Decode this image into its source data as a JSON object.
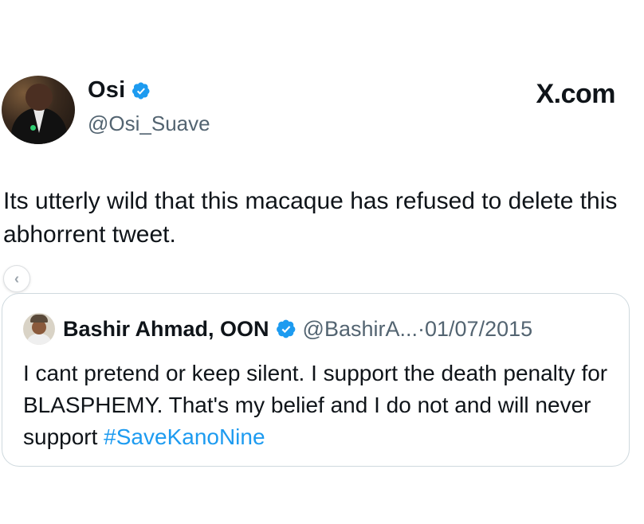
{
  "author": {
    "display_name": "Osi",
    "handle": "@Osi_Suave",
    "verified": true
  },
  "brand": "X.com",
  "tweet_text": "Its utterly wild that this macaque has refused to delete this abhorrent tweet.",
  "quoted_tweet": {
    "display_name": "Bashir Ahmad, OON",
    "verified": true,
    "handle_truncated": "@BashirA...",
    "separator": "·",
    "date": "01/07/2015",
    "text": "I cant pretend or keep silent. I support the death penalty for BLASPHEMY. That's my belief and I do not and will never support ",
    "hashtag": "#SaveKanoNine"
  },
  "icons": {
    "verified": "verified-badge-icon",
    "carousel_prev": "chevron-left-icon"
  },
  "colors": {
    "verified_blue": "#1d9bf0",
    "hashtag_blue": "#1d9bf0",
    "secondary_text": "#536471",
    "border": "#cfd9de"
  }
}
